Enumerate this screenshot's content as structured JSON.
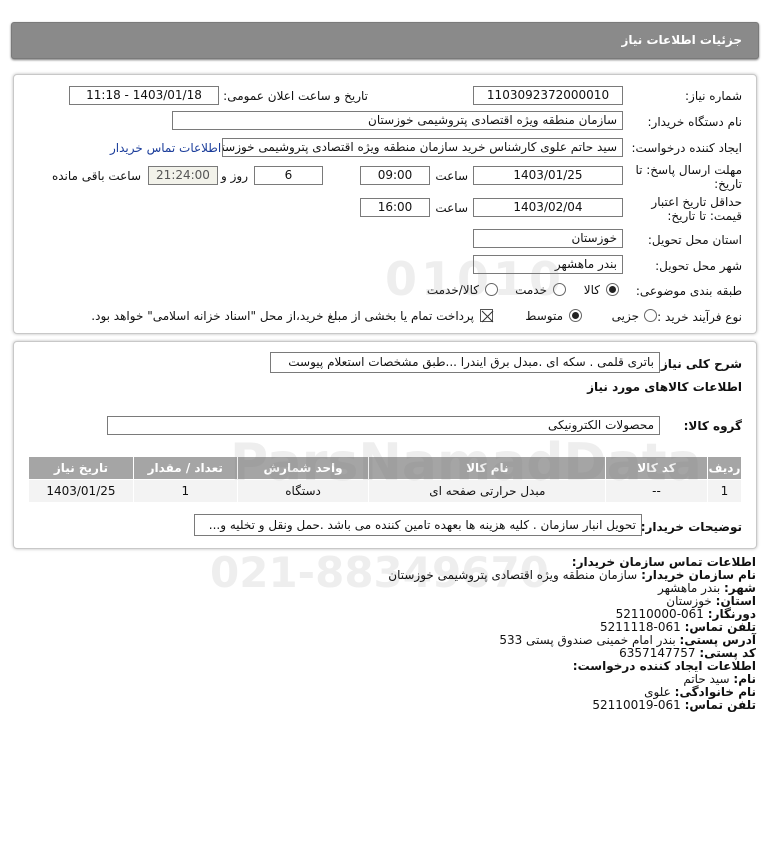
{
  "header": {
    "title": "جزئیات اطلاعات نیاز"
  },
  "form": {
    "need_number_label": "شماره نیاز:",
    "need_number": "1103092372000010",
    "announce_label": "تاریخ و ساعت اعلان عمومی:",
    "announce_value": "1403/01/18 - 11:18",
    "buyer_org_label": "نام دستگاه خریدار:",
    "buyer_org": "سازمان منطقه ویژه اقتصادی پتروشیمی خوزستان",
    "creator_label": "ایجاد کننده درخواست:",
    "creator": "سید حاتم علوی کارشناس خرید سازمان منطقه ویژه اقتصادی پتروشیمی خوزستان",
    "contact_link": "اطلاعات تماس خریدار",
    "deadline_label_1": "مهلت ارسال پاسخ: تا",
    "deadline_label_2": "تاریخ:",
    "deadline_date": "1403/01/25",
    "time_label": "ساعت",
    "deadline_time": "09:00",
    "days": "6",
    "days_label": "روز و",
    "remaining": "21:24:00",
    "remaining_label": "ساعت باقی مانده",
    "validity_label_1": "حداقل تاریخ اعتبار",
    "validity_label_2": "قیمت: تا تاریخ:",
    "validity_date": "1403/02/04",
    "validity_time": "16:00",
    "province_label": "استان محل تحویل:",
    "province": "خوزستان",
    "city_label": "شهر محل تحویل:",
    "city": "بندر ماهشهر",
    "category_label": "طبقه بندی موضوعی:",
    "category_options": [
      "کالا",
      "خدمت",
      "کالا/خدمت"
    ],
    "category_selected": "کالا",
    "process_label": "نوع فرآیند خرید :",
    "process_options": [
      "جزیی",
      "متوسط"
    ],
    "process_selected": "متوسط",
    "payment_note": "پرداخت تمام یا بخشی از مبلغ خرید،از محل \"اسناد خزانه اسلامی\" خواهد بود."
  },
  "details": {
    "summary_label": "شرح کلی نیاز:",
    "summary": "باتری قلمی . سکه ای .مبدل برق ایندرا ...طبق مشخصات استعلام پیوست",
    "goods_info_title": "اطلاعات کالاهای مورد نیاز",
    "group_label": "گروه کالا:",
    "group": "محصولات الکترونیکی",
    "table_headers": [
      "ردیف",
      "کد کالا",
      "نام کالا",
      "واحد شمارش",
      "تعداد / مقدار",
      "تاریخ نیاز"
    ],
    "rows": [
      {
        "row": "1",
        "code": "--",
        "name": "مبدل حرارتی صفحه ای",
        "unit": "دستگاه",
        "qty": "1",
        "date": "1403/01/25"
      }
    ],
    "buyer_notes_label": "توضیحات خریدار:",
    "buyer_notes": "تحویل انبار سازمان . کلیه هزینه ها بعهده تامین کننده می باشد .حمل ونقل و تخلیه و..."
  },
  "contact": {
    "title": "اطلاعات تماس سازمان خریدار:",
    "org_label": "نام سازمان خریدار:",
    "org": "سازمان منطقه ویژه اقتصادی پتروشیمی خوزستان",
    "city_label": "شهر:",
    "city": "بندر ماهشهر",
    "province_label": "استان:",
    "province": "خوزستان",
    "fax_label": "دورنگار:",
    "fax": "061-52110000",
    "phone_label": "تلفن تماس:",
    "phone": "061-5211118",
    "address_label": "آدرس پستی:",
    "address": "بندر امام خمینی صندوق پستی 533",
    "postal_label": "کد پستی:",
    "postal": "6357147757",
    "creator_title": "اطلاعات ایجاد کننده درخواست:",
    "name_label": "نام:",
    "name": "سید حاتم",
    "family_label": "نام خانوادگی:",
    "family": "علوی",
    "creator_phone_label": "تلفن تماس:",
    "creator_phone": "061-52110019"
  },
  "watermark": {
    "brand": "ParsNamadData",
    "phone": "021-88349670"
  }
}
